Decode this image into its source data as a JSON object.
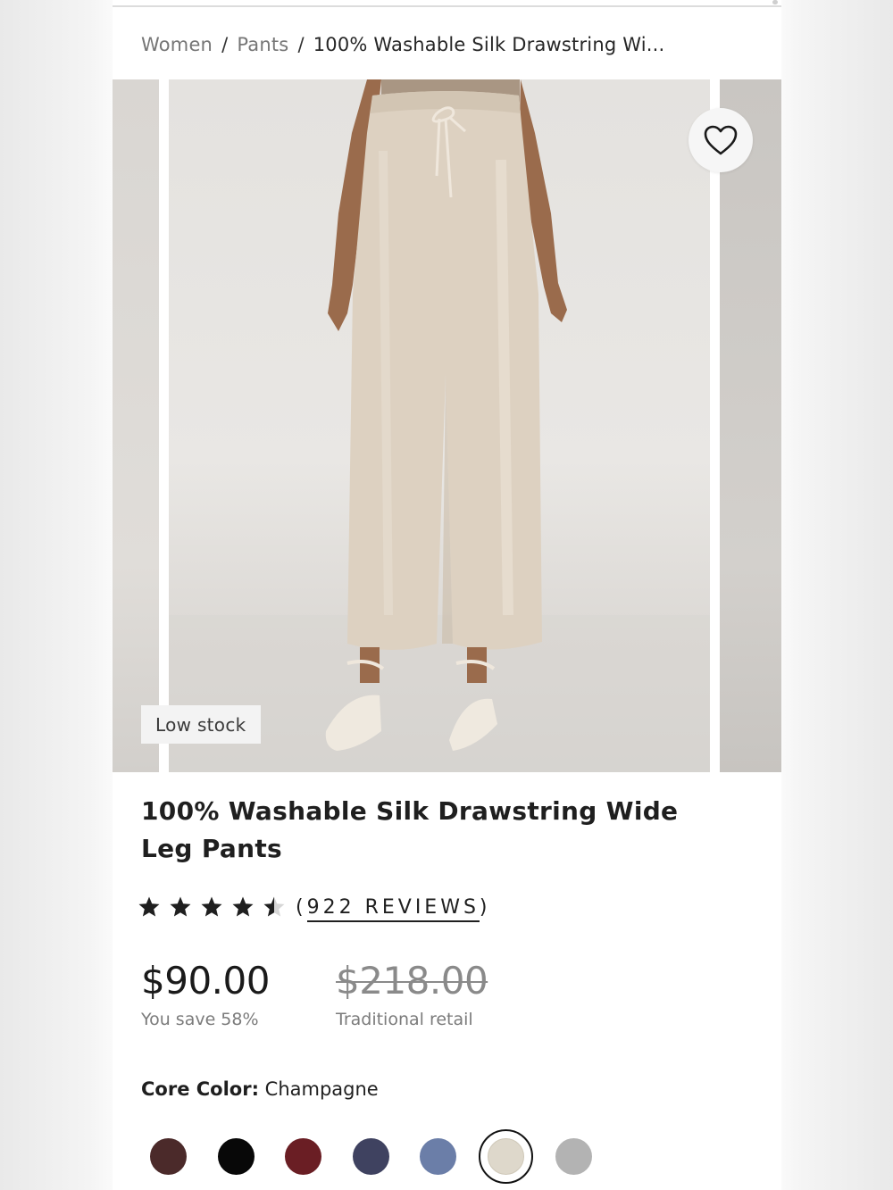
{
  "breadcrumb": {
    "items": [
      "Women",
      "Pants"
    ],
    "separator": "/",
    "current": "100% Washable Silk Drawstring Wi..."
  },
  "product": {
    "stock_badge": "Low stock",
    "title": "100% Washable Silk Drawstring Wide Leg Pants",
    "rating": 4.5,
    "reviews_open": "(",
    "reviews_text": "922 REVIEWS",
    "reviews_close": ")",
    "price": "$90.00",
    "savings": "You save 58%",
    "retail_price": "$218.00",
    "retail_label": "Traditional retail"
  },
  "color": {
    "label": "Core Color:",
    "selected": "Champagne",
    "swatches": [
      "#4b2a2a",
      "#080808",
      "#6a1e24",
      "#3f4260",
      "#6b7ea8",
      "#ded8cb",
      "#b3b3b3"
    ],
    "selected_index": 5
  },
  "icons": {
    "favorite": "heart-outline-icon",
    "star": "star-icon"
  }
}
